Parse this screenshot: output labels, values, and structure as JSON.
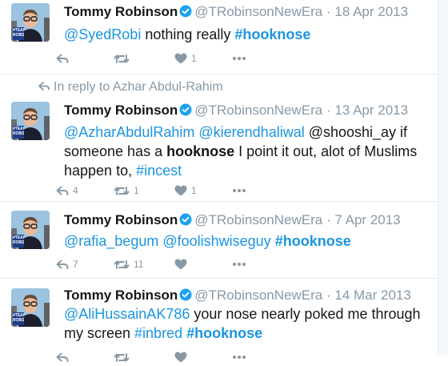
{
  "tweets": [
    {
      "name": "Tommy Robinson",
      "handle": "@TRobinsonNewEra",
      "separator": "·",
      "date": "18 Apr 2013",
      "reply_context": "",
      "body": [
        {
          "t": "@SyedRobi",
          "s": "link"
        },
        {
          "t": " nothing really ",
          "s": "text"
        },
        {
          "t": "#hooknose",
          "s": "link-bold"
        }
      ],
      "counts": {
        "reply": "",
        "retweet": "",
        "like": "1"
      }
    },
    {
      "name": "Tommy Robinson",
      "handle": "@TRobinsonNewEra",
      "separator": "·",
      "date": "13 Apr 2013",
      "reply_context": "In reply to Azhar Abdul-Rahim",
      "body": [
        {
          "t": "@AzharAbdulRahim",
          "s": "link"
        },
        {
          "t": " ",
          "s": "text"
        },
        {
          "t": "@kierendhaliwal",
          "s": "link"
        },
        {
          "t": " @shooshi_ay if someone has a ",
          "s": "text"
        },
        {
          "t": "hooknose",
          "s": "bold"
        },
        {
          "t": " I point it out, alot of Muslims happen to, ",
          "s": "text"
        },
        {
          "t": "#incest",
          "s": "link"
        }
      ],
      "counts": {
        "reply": "4",
        "retweet": "1",
        "like": "1"
      }
    },
    {
      "name": "Tommy Robinson",
      "handle": "@TRobinsonNewEra",
      "separator": "·",
      "date": "7 Apr 2013",
      "reply_context": "",
      "body": [
        {
          "t": "@rafia_begum",
          "s": "link"
        },
        {
          "t": " ",
          "s": "text"
        },
        {
          "t": "@foolishwiseguy",
          "s": "link"
        },
        {
          "t": " ",
          "s": "text"
        },
        {
          "t": "#hooknose",
          "s": "link-bold"
        }
      ],
      "counts": {
        "reply": "7",
        "retweet": "11",
        "like": ""
      }
    },
    {
      "name": "Tommy Robinson",
      "handle": "@TRobinsonNewEra",
      "separator": "·",
      "date": "14 Mar 2013",
      "reply_context": "",
      "body": [
        {
          "t": "@AliHussainAK786",
          "s": "link"
        },
        {
          "t": " your nose nearly poked me through my screen ",
          "s": "text"
        },
        {
          "t": "#inbred",
          "s": "link"
        },
        {
          "t": " ",
          "s": "text"
        },
        {
          "t": "#hooknose",
          "s": "link-bold"
        }
      ],
      "counts": {
        "reply": "",
        "retweet": "",
        "like": ""
      }
    }
  ],
  "avatar_badge_text": "#TEAM ROBSON",
  "colors": {
    "link": "#1b95e0",
    "meta": "#8899a6",
    "verified": "#1da1f2",
    "border": "#e6ecf0"
  },
  "icons": {
    "reply": "reply-icon",
    "retweet": "retweet-icon",
    "like": "heart-icon",
    "more": "more-dots-icon",
    "verified": "verified-badge-icon"
  }
}
